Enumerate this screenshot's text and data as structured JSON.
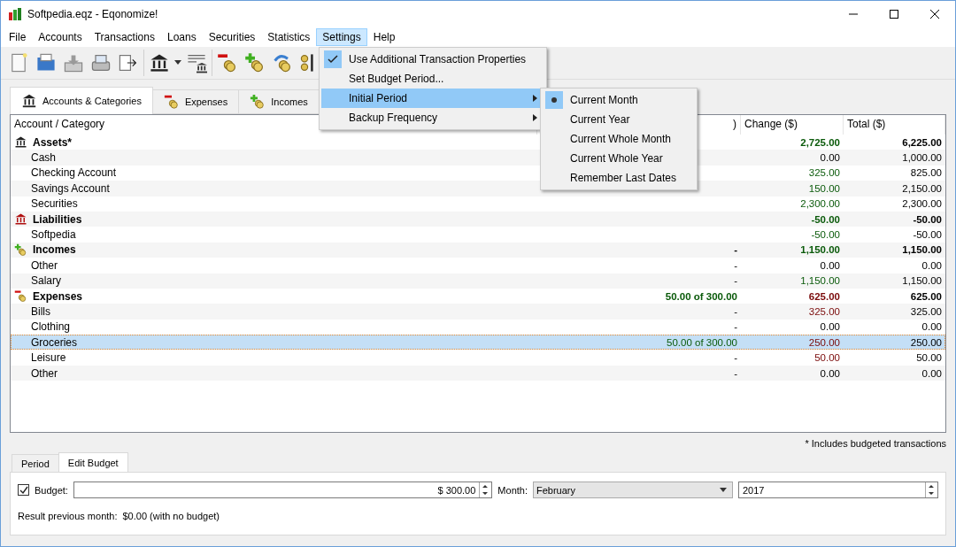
{
  "window": {
    "title": "Softpedia.eqz - Eqonomize!"
  },
  "menu_bar": [
    {
      "label": "File",
      "selected": false
    },
    {
      "label": "Accounts",
      "selected": false
    },
    {
      "label": "Transactions",
      "selected": false
    },
    {
      "label": "Loans",
      "selected": false
    },
    {
      "label": "Securities",
      "selected": false
    },
    {
      "label": "Statistics",
      "selected": false
    },
    {
      "label": "Settings",
      "selected": true
    },
    {
      "label": "Help",
      "selected": false
    }
  ],
  "toolbar": [
    {
      "kind": "new"
    },
    {
      "kind": "open"
    },
    {
      "kind": "save"
    },
    {
      "kind": "print"
    },
    {
      "kind": "exit"
    },
    {
      "kind": "sep"
    },
    {
      "kind": "bank"
    },
    {
      "kind": "dropdown"
    },
    {
      "kind": "banklist"
    },
    {
      "kind": "sep"
    },
    {
      "kind": "expense"
    },
    {
      "kind": "income"
    },
    {
      "kind": "transfer"
    },
    {
      "kind": "securities"
    }
  ],
  "tabs": [
    {
      "label": "Accounts & Categories",
      "kind": "bank",
      "selected": true
    },
    {
      "label": "Expenses",
      "kind": "expense",
      "selected": false
    },
    {
      "label": "Incomes",
      "kind": "income",
      "selected": false
    }
  ],
  "table": {
    "columns": [
      "Account / Category",
      ")",
      "Change ($)",
      "Total ($)"
    ],
    "rows": [
      {
        "kind": "bank",
        "name": "Assets*",
        "budget": "",
        "change": {
          "text": "2,725.00",
          "kind": "gain"
        },
        "total": "6,225.00",
        "selected": false
      },
      {
        "kind": "item",
        "name": "Cash",
        "budget": "",
        "change": {
          "text": "0.00",
          "kind": "neutral"
        },
        "total": "1,000.00",
        "selected": false
      },
      {
        "kind": "item",
        "name": "Checking Account",
        "budget": "",
        "change": {
          "text": "325.00",
          "kind": "gain"
        },
        "total": "825.00",
        "selected": false
      },
      {
        "kind": "item",
        "name": "Savings Account",
        "budget": "",
        "change": {
          "text": "150.00",
          "kind": "gain"
        },
        "total": "2,150.00",
        "selected": false
      },
      {
        "kind": "item",
        "name": "Securities",
        "budget": "",
        "change": {
          "text": "2,300.00",
          "kind": "gain"
        },
        "total": "2,300.00",
        "selected": false
      },
      {
        "kind": "liability",
        "name": "Liabilities",
        "budget": "",
        "change": {
          "text": "-50.00",
          "kind": "gain"
        },
        "total": "-50.00",
        "selected": false
      },
      {
        "kind": "item",
        "name": "Softpedia",
        "budget": "",
        "change": {
          "text": "-50.00",
          "kind": "gain"
        },
        "total": "-50.00",
        "selected": false
      },
      {
        "kind": "income",
        "name": "Incomes",
        "budget": "-",
        "change": {
          "text": "1,150.00",
          "kind": "gain"
        },
        "total": "1,150.00",
        "selected": false
      },
      {
        "kind": "item",
        "name": "Other",
        "budget": "-",
        "change": {
          "text": "0.00",
          "kind": "neutral"
        },
        "total": "0.00",
        "selected": false
      },
      {
        "kind": "item",
        "name": "Salary",
        "budget": "-",
        "change": {
          "text": "1,150.00",
          "kind": "gain"
        },
        "total": "1,150.00",
        "selected": false
      },
      {
        "kind": "expense",
        "name": "Expenses",
        "budget": "50.00 of 300.00",
        "change": {
          "text": "625.00",
          "kind": "loss"
        },
        "total": "625.00",
        "selected": false
      },
      {
        "kind": "item",
        "name": "Bills",
        "budget": "-",
        "change": {
          "text": "325.00",
          "kind": "loss"
        },
        "total": "325.00",
        "selected": false
      },
      {
        "kind": "item",
        "name": "Clothing",
        "budget": "-",
        "change": {
          "text": "0.00",
          "kind": "neutral"
        },
        "total": "0.00",
        "selected": false
      },
      {
        "kind": "item",
        "name": "Groceries",
        "budget": "50.00 of 300.00",
        "change": {
          "text": "250.00",
          "kind": "loss"
        },
        "total": "250.00",
        "selected": true
      },
      {
        "kind": "item",
        "name": "Leisure",
        "budget": "-",
        "change": {
          "text": "50.00",
          "kind": "loss"
        },
        "total": "50.00",
        "selected": false
      },
      {
        "kind": "item",
        "name": "Other",
        "budget": "-",
        "change": {
          "text": "0.00",
          "kind": "neutral"
        },
        "total": "0.00",
        "selected": false
      }
    ]
  },
  "footnote": "* Includes budgeted transactions",
  "bottom_tabs": [
    {
      "label": "Period",
      "selected": false
    },
    {
      "label": "Edit Budget",
      "selected": true
    }
  ],
  "budget_form": {
    "checked": true,
    "label": "Budget:",
    "amount": "$ 300.00",
    "month_label": "Month:",
    "month": "February",
    "year": "2017",
    "result_label": "Result previous month:",
    "result": "$0.00 (with no budget)"
  },
  "settings_menu": {
    "items": [
      {
        "label": "Use Additional Transaction Properties",
        "checked": true,
        "submenu": false,
        "selected": false
      },
      {
        "label": "Set Budget Period...",
        "checked": false,
        "submenu": false,
        "selected": false
      },
      {
        "label": "Initial Period",
        "checked": false,
        "submenu": true,
        "selected": true
      },
      {
        "label": "Backup Frequency",
        "checked": false,
        "submenu": true,
        "selected": false
      }
    ]
  },
  "submenu": {
    "items": [
      {
        "label": "Current Month",
        "selected": true
      },
      {
        "label": "Current Year",
        "selected": false
      },
      {
        "label": "Current Whole Month",
        "selected": false
      },
      {
        "label": "Current Whole Year",
        "selected": false
      },
      {
        "label": "Remember Last Dates",
        "selected": false
      }
    ]
  }
}
